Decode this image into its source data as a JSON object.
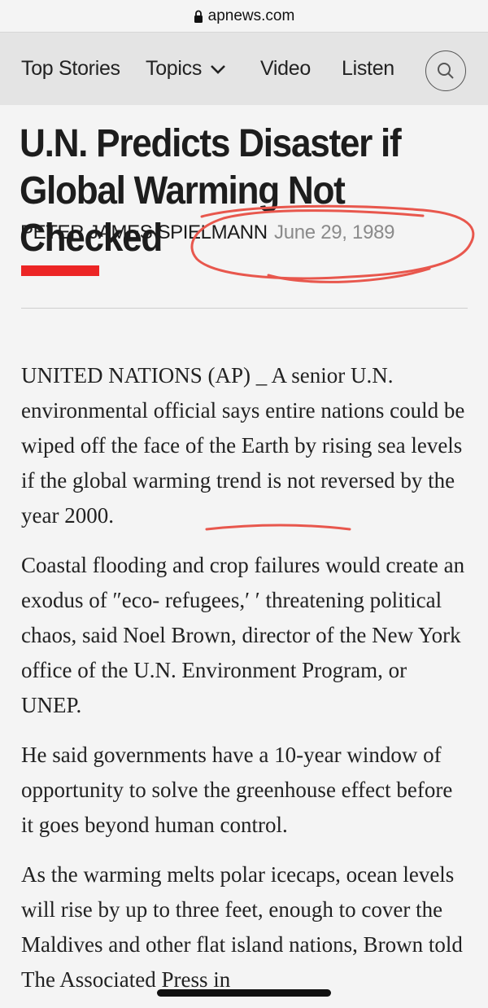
{
  "browser": {
    "url": "apnews.com"
  },
  "nav": {
    "items": [
      {
        "label": "Top Stories"
      },
      {
        "label": "Topics"
      },
      {
        "label": "Video"
      },
      {
        "label": "Listen"
      }
    ]
  },
  "article": {
    "headline": "U.N. Predicts Disaster if Global Warming Not Checked",
    "author": "PETER JAMES SPIELMANN",
    "date": "June 29, 1989",
    "paragraphs": [
      "UNITED NATIONS (AP) _ A senior U.N. environmental official says entire nations could be wiped off the face of the Earth by rising sea levels if the global warming trend is not reversed by the year 2000.",
      "Coastal flooding and crop failures would create an exodus of ″eco- refugees,′ ′ threatening political chaos, said Noel Brown, director of the New York office of the U.N. Environment Program, or UNEP.",
      "He said governments have a 10-year window of opportunity to solve the greenhouse effect before it goes beyond human control.",
      "As the warming melts polar icecaps, ocean levels will rise by up to three feet, enough to cover the Maldives and other flat island nations, Brown told The Associated Press in"
    ]
  },
  "colors": {
    "accent_red": "#ec2525",
    "annotation": "#e8574d"
  }
}
